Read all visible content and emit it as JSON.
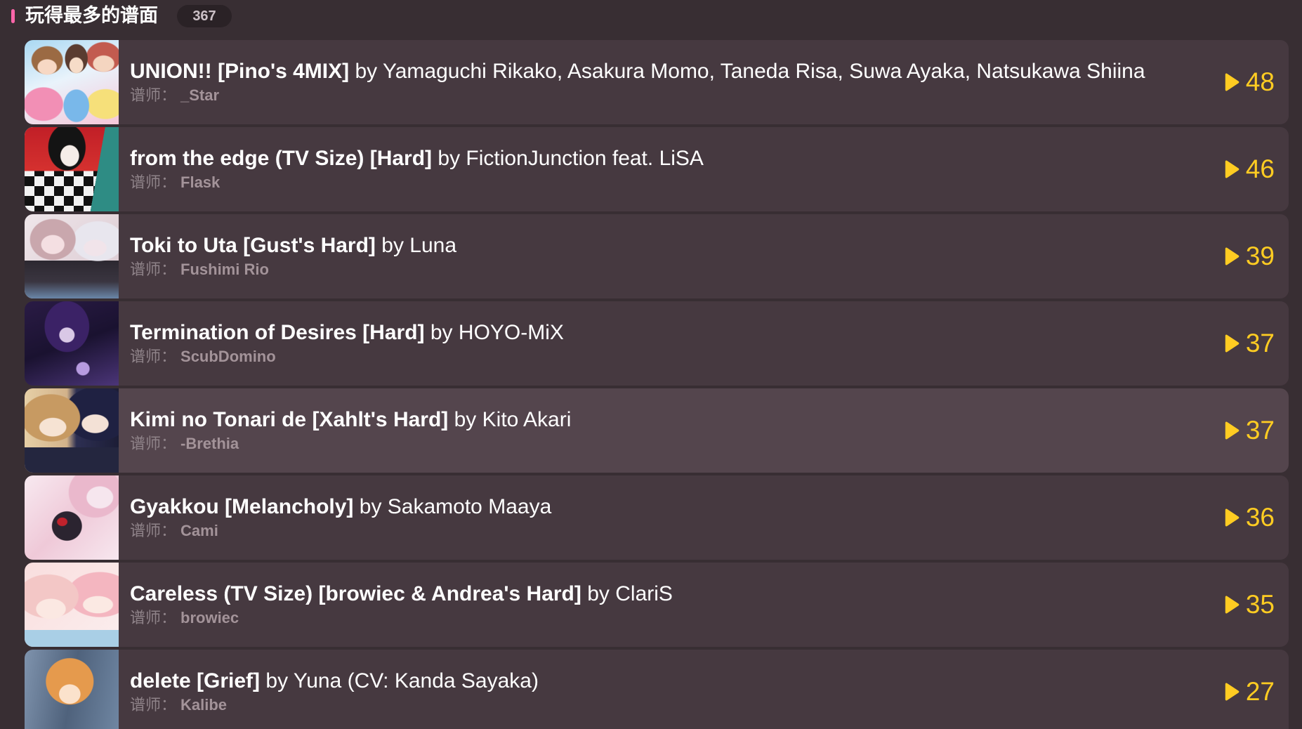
{
  "section": {
    "title": "玩得最多的谱面",
    "count": "367"
  },
  "labels": {
    "by": "by",
    "mapper": "谱师："
  },
  "icons": {
    "play_count": "play-icon"
  },
  "colors": {
    "page_background": "#382e33",
    "row_background": "#463940",
    "row_hover_background": "#54454d",
    "badge_background": "#2a2226",
    "accent_pink": "#ff66aa",
    "play_count_yellow": "#ffcc22"
  },
  "beatmaps": [
    {
      "title": "UNION!! [Pino's 4MIX]",
      "artist": "Yamaguchi Rikako, Asakura Momo, Taneda Risa, Suwa Ayaka, Natsukawa Shiina",
      "mapper": "_Star",
      "play_count": "48"
    },
    {
      "title": "from the edge (TV Size) [Hard]",
      "artist": "FictionJunction feat. LiSA",
      "mapper": "Flask",
      "play_count": "46"
    },
    {
      "title": "Toki to Uta [Gust's Hard]",
      "artist": "Luna",
      "mapper": "Fushimi Rio",
      "play_count": "39"
    },
    {
      "title": "Termination of Desires [Hard]",
      "artist": "HOYO-MiX",
      "mapper": "ScubDomino",
      "play_count": "37"
    },
    {
      "title": "Kimi no Tonari de [Xahlt's Hard]",
      "artist": "Kito Akari",
      "mapper": "-Brethia",
      "play_count": "37"
    },
    {
      "title": "Gyakkou [Melancholy]",
      "artist": "Sakamoto Maaya",
      "mapper": "Cami",
      "play_count": "36"
    },
    {
      "title": "Careless (TV Size) [browiec & Andrea's Hard]",
      "artist": "ClariS",
      "mapper": "browiec",
      "play_count": "35"
    },
    {
      "title": "delete [Grief]",
      "artist": "Yuna (CV: Kanda Sayaka)",
      "mapper": "Kalibe",
      "play_count": "27"
    }
  ]
}
